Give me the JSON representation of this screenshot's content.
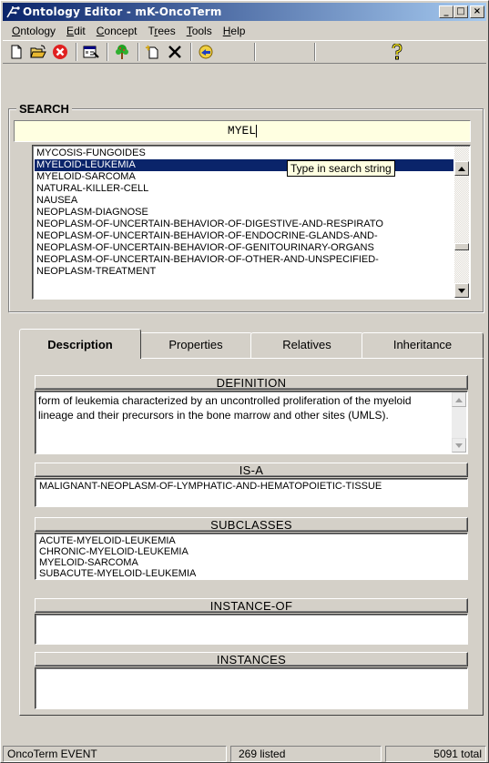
{
  "window": {
    "title": "Ontology Editor - mK-OncoTerm",
    "minimize": "_",
    "maximize": "□",
    "close": "×"
  },
  "menu": [
    {
      "key": "O",
      "rest": "ntology"
    },
    {
      "key": "E",
      "rest": "dit"
    },
    {
      "key": "C",
      "rest": "oncept"
    },
    {
      "key": "T",
      "rest": "rees"
    },
    {
      "key": "T",
      "rest": "ools"
    },
    {
      "key": "H",
      "rest": "elp"
    }
  ],
  "toolbar": {
    "icons": [
      "new-file-icon",
      "open-folder-icon",
      "delete-red-icon",
      "properties-icon",
      "tree-icon",
      "new-concept-icon",
      "cross-delete-icon",
      "search-icon",
      "help-question-icon"
    ]
  },
  "search": {
    "group_title": "SEARCH",
    "query": "MYEL",
    "tooltip": "Type in search string",
    "results": [
      "MYCOSIS-FUNGOIDES",
      "MYELOID-LEUKEMIA",
      "MYELOID-SARCOMA",
      "NATURAL-KILLER-CELL",
      "NAUSEA",
      "NEOPLASM-DIAGNOSE",
      "NEOPLASM-OF-UNCERTAIN-BEHAVIOR-OF-DIGESTIVE-AND-RESPIRATO",
      "NEOPLASM-OF-UNCERTAIN-BEHAVIOR-OF-ENDOCRINE-GLANDS-AND-",
      "NEOPLASM-OF-UNCERTAIN-BEHAVIOR-OF-GENITOURINARY-ORGANS",
      "NEOPLASM-OF-UNCERTAIN-BEHAVIOR-OF-OTHER-AND-UNSPECIFIED-",
      "NEOPLASM-TREATMENT"
    ],
    "selected": "MYELOID-LEUKEMIA"
  },
  "tabs": [
    "Description",
    "Properties",
    "Relatives",
    "Inheritance"
  ],
  "active_tab": "Description",
  "description": {
    "definition_header": "DEFINITION",
    "definition": "form of leukemia characterized by an uncontrolled proliferation of the myeloid lineage and their precursors in the bone marrow and other sites (UMLS).",
    "isa_header": "IS-A",
    "isa": [
      "MALIGNANT-NEOPLASM-OF-LYMPHATIC-AND-HEMATOPOIETIC-TISSUE"
    ],
    "subclasses_header": "SUBCLASSES",
    "subclasses": [
      "ACUTE-MYELOID-LEUKEMIA",
      "CHRONIC-MYELOID-LEUKEMIA",
      "MYELOID-SARCOMA",
      "SUBACUTE-MYELOID-LEUKEMIA"
    ],
    "instance_of_header": "INSTANCE-OF",
    "instances_header": "INSTANCES"
  },
  "status": {
    "mode": "OncoTerm EVENT",
    "listed": "269 listed",
    "total": "5091 total"
  },
  "colors": {
    "titlebar_start": "#0a246a",
    "titlebar_end": "#a6caf0",
    "selection": "#0a246a",
    "search_bg": "#ffffe1",
    "window_bg": "#d4d0c8"
  }
}
